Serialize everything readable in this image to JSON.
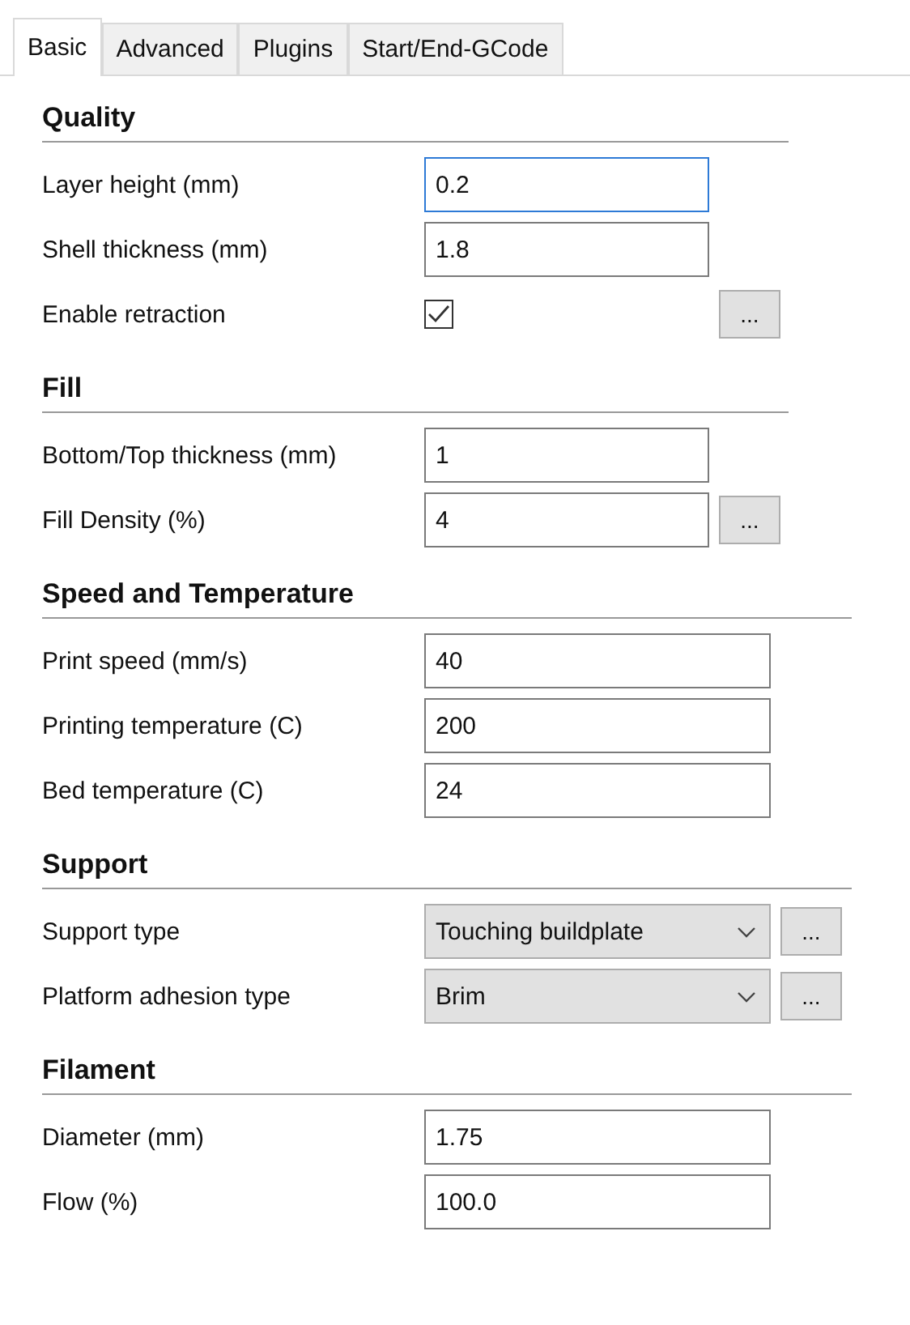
{
  "tabs": [
    {
      "label": "Basic",
      "selected": true
    },
    {
      "label": "Advanced",
      "selected": false
    },
    {
      "label": "Plugins",
      "selected": false
    },
    {
      "label": "Start/End-GCode",
      "selected": false
    }
  ],
  "sections": [
    {
      "title": "Quality",
      "rows": [
        {
          "kind": "text",
          "label": "Layer height (mm)",
          "value": "0.2",
          "focused": true
        },
        {
          "kind": "text",
          "label": "Shell thickness (mm)",
          "value": "1.8",
          "focused": false
        },
        {
          "kind": "checkbox",
          "label": "Enable retraction",
          "checked": true,
          "options_button": "..."
        }
      ]
    },
    {
      "title": "Fill",
      "rows": [
        {
          "kind": "text",
          "label": "Bottom/Top thickness (mm)",
          "value": "1",
          "focused": false
        },
        {
          "kind": "text",
          "label": "Fill Density (%)",
          "value": "4",
          "focused": false,
          "options_button": "..."
        }
      ]
    },
    {
      "title": "Speed and Temperature",
      "rows": [
        {
          "kind": "text",
          "label": "Print speed (mm/s)",
          "value": "40",
          "focused": false
        },
        {
          "kind": "text",
          "label": "Printing temperature (C)",
          "value": "200",
          "focused": false
        },
        {
          "kind": "text",
          "label": "Bed temperature (C)",
          "value": "24",
          "focused": false
        }
      ]
    },
    {
      "title": "Support",
      "rows": [
        {
          "kind": "combo",
          "label": "Support type",
          "value": "Touching buildplate",
          "options_button": "..."
        },
        {
          "kind": "combo",
          "label": "Platform adhesion type",
          "value": "Brim",
          "options_button": "..."
        }
      ]
    },
    {
      "title": "Filament",
      "rows": [
        {
          "kind": "text",
          "label": "Diameter (mm)",
          "value": "1.75",
          "focused": false
        },
        {
          "kind": "text",
          "label": "Flow (%)",
          "value": "100.0",
          "focused": false
        }
      ]
    }
  ]
}
